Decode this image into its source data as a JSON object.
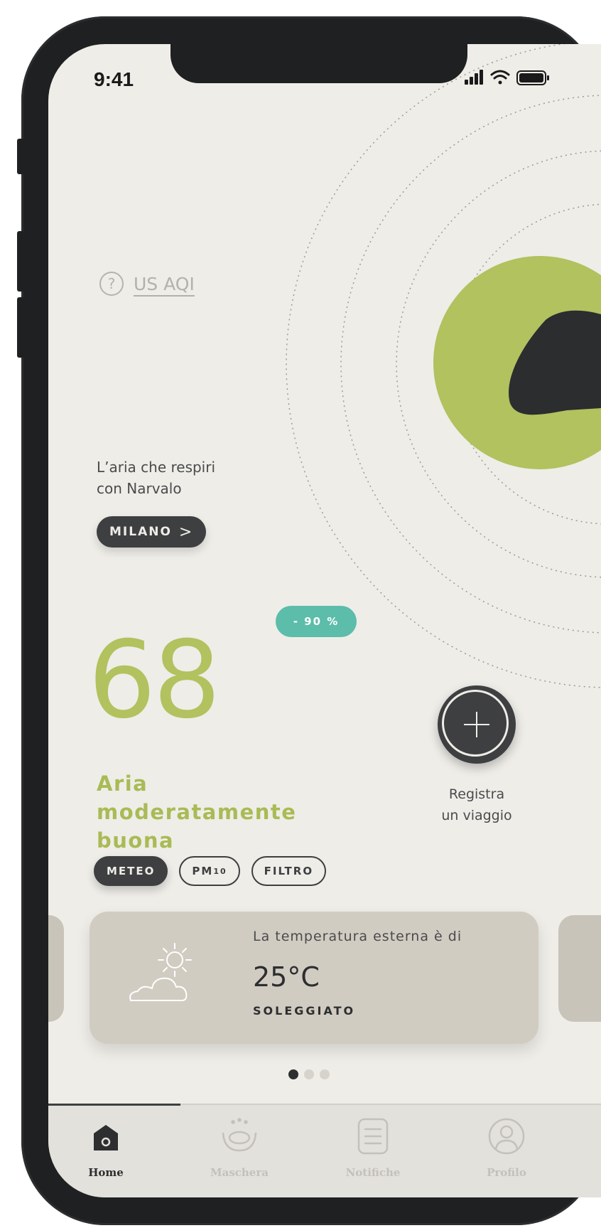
{
  "status_bar": {
    "time": "9:41",
    "icons": [
      "signal-icon",
      "wifi-icon",
      "battery-icon"
    ]
  },
  "header": {
    "aqi_help_icon": "?",
    "aqi_label": "US AQI"
  },
  "intro": {
    "line1": "L’aria che respiri",
    "line2": "con Narvalo"
  },
  "city": {
    "name": "MILANO",
    "chevron": ">"
  },
  "reduction_badge": "- 90 %",
  "aqi": {
    "value": "68",
    "quality_line1": "Aria",
    "quality_line2": "moderatamente",
    "quality_line3": "buona",
    "color": "#b1c25f"
  },
  "trip": {
    "label_line1": "Registra",
    "label_line2": "un viaggio"
  },
  "filters": {
    "chips": [
      {
        "label": "METEO",
        "active": true
      },
      {
        "label": "PM10",
        "active": false
      },
      {
        "label": "FILTRO",
        "active": false
      }
    ]
  },
  "weather_card": {
    "label": "La temperatura esterna è di",
    "temperature": "25°C",
    "condition": "SOLEGGIATO",
    "icon": "sun-cloud-icon"
  },
  "carousel": {
    "pages": 3,
    "active_index": 0
  },
  "tabs": [
    {
      "label": "Home",
      "icon": "home-icon",
      "active": true
    },
    {
      "label": "Maschera",
      "icon": "mask-icon",
      "active": false
    },
    {
      "label": "Notifiche",
      "icon": "notifications-icon",
      "active": false
    },
    {
      "label": "Profilo",
      "icon": "profile-icon",
      "active": false
    }
  ],
  "colors": {
    "background": "#efede8",
    "accent_green": "#b1c25f",
    "teal_badge": "#5bbdaa",
    "dark": "#3d3f41",
    "card": "#d1ccc2"
  }
}
